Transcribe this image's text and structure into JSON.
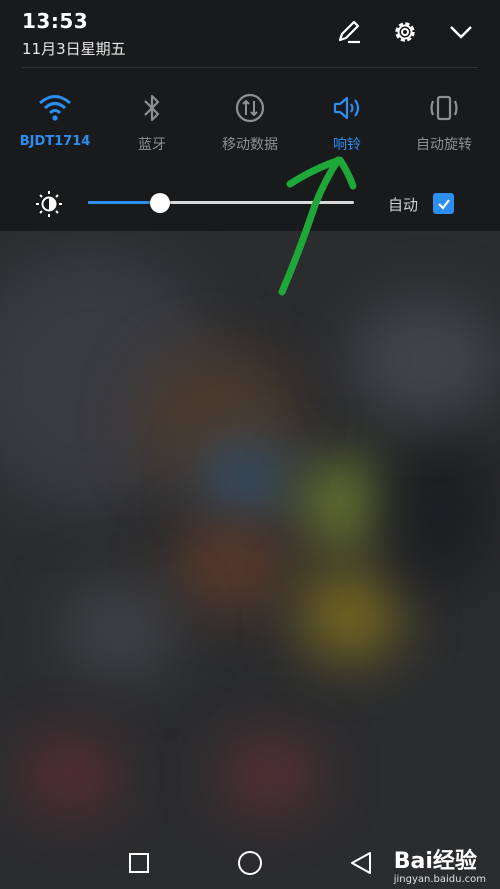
{
  "status": {
    "time": "13:53",
    "date": "11月3日星期五"
  },
  "header": {
    "edit_icon": "pencil-icon",
    "settings_icon": "gear-icon",
    "collapse_icon": "chevron-down-icon"
  },
  "tiles": [
    {
      "label": "BJDT1714",
      "icon": "wifi-icon",
      "active": true
    },
    {
      "label": "蓝牙",
      "icon": "bluetooth-icon",
      "active": false
    },
    {
      "label": "移动数据",
      "icon": "mobile-data-icon",
      "active": false
    },
    {
      "label": "响铃",
      "icon": "volume-icon",
      "active": true
    },
    {
      "label": "自动旋转",
      "icon": "rotate-icon",
      "active": false
    }
  ],
  "brightness": {
    "level_percent": 27,
    "auto_label": "自动",
    "auto_checked": true
  },
  "watermark": {
    "brand": "Bai经验",
    "url": "jingyan.baidu.com"
  },
  "colors": {
    "accent": "#2c8ef0",
    "annotation": "#1fa83a",
    "panel": "#191a1c"
  }
}
